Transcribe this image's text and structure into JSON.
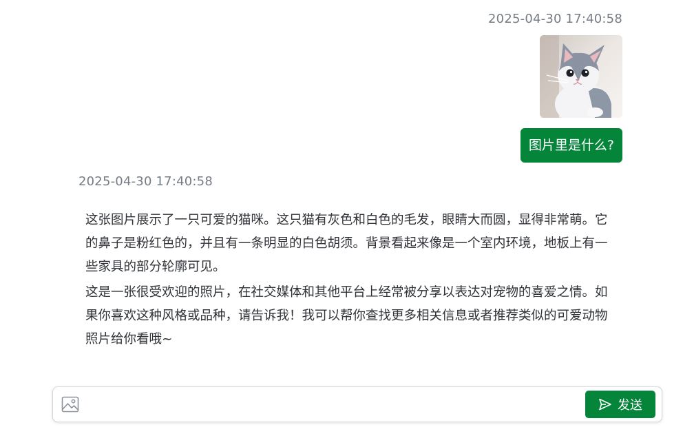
{
  "conversation": {
    "user_message": {
      "timestamp": "2025-04-30 17:40:58",
      "image_alt": "灰白色小猫照片",
      "text": "图片里是什么?"
    },
    "bot_message": {
      "timestamp": "2025-04-30 17:40:58",
      "paragraphs": [
        "这张图片展示了一只可爱的猫咪。这只猫有灰色和白色的毛发，眼睛大而圆，显得非常萌。它的鼻子是粉红色的，并且有一条明显的白色胡须。背景看起来像是一个室内环境，地板上有一些家具的部分轮廓可见。",
        "这是一张很受欢迎的照片，在社交媒体和其他平台上经常被分享以表达对宠物的喜爱之情。如果你喜欢这种风格或品种，请告诉我！我可以帮你查找更多相关信息或者推荐类似的可爱动物照片给你看哦~"
      ]
    }
  },
  "input_bar": {
    "value": "",
    "placeholder": "",
    "upload_icon": "image-icon",
    "send_icon": "send-icon",
    "send_label": "发送"
  },
  "colors": {
    "accent": "#04853a",
    "timestamp": "#767c84",
    "text": "#2f3237"
  }
}
